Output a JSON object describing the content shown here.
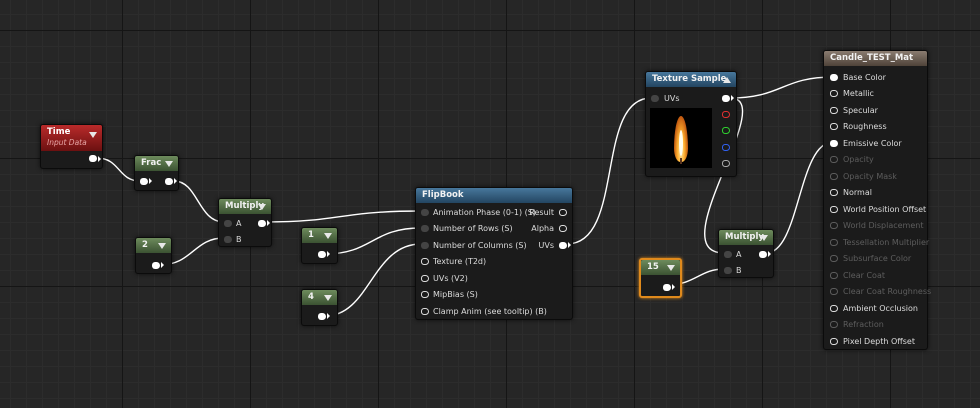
{
  "nodes": {
    "time": {
      "title": "Time",
      "subtitle": "Input Data"
    },
    "frac": {
      "title": "Frac"
    },
    "multiply1": {
      "title": "Multiply",
      "input_a": "A",
      "input_b": "B"
    },
    "const2": {
      "value": "2"
    },
    "const1": {
      "value": "1"
    },
    "const4": {
      "value": "4"
    },
    "flipbook": {
      "title": "FlipBook",
      "inputs": [
        "Animation  Phase (0-1) (S)",
        "Number of Rows (S)",
        "Number of Columns (S)",
        "Texture (T2d)",
        "UVs (V2)",
        "MipBias (S)",
        "Clamp Anim (see tooltip) (B)"
      ],
      "outputs": [
        "Result",
        "Alpha",
        "UVs"
      ]
    },
    "texture_sample": {
      "title": "Texture Sample",
      "input_uvs": "UVs"
    },
    "const15": {
      "value": "15"
    },
    "multiply2": {
      "title": "Multiply",
      "input_a": "A",
      "input_b": "B"
    },
    "material": {
      "title": "Candle_TEST_Mat",
      "inputs": [
        {
          "label": "Base Color",
          "active": true
        },
        {
          "label": "Metallic",
          "active": true
        },
        {
          "label": "Specular",
          "active": true
        },
        {
          "label": "Roughness",
          "active": true
        },
        {
          "label": "Emissive Color",
          "active": true
        },
        {
          "label": "Opacity",
          "active": false
        },
        {
          "label": "Opacity Mask",
          "active": false
        },
        {
          "label": "Normal",
          "active": true
        },
        {
          "label": "World Position Offset",
          "active": true
        },
        {
          "label": "World Displacement",
          "active": false
        },
        {
          "label": "Tessellation Multiplier",
          "active": false
        },
        {
          "label": "Subsurface Color",
          "active": false
        },
        {
          "label": "Clear Coat",
          "active": false
        },
        {
          "label": "Clear Coat Roughness",
          "active": false
        },
        {
          "label": "Ambient Occlusion",
          "active": true
        },
        {
          "label": "Refraction",
          "active": false
        },
        {
          "label": "Pixel Depth Offset",
          "active": true
        }
      ]
    }
  },
  "colors": {
    "wire": "#ffffff",
    "time_header": "#8b1c1c",
    "function_header": "#4a6a3e",
    "texture_header": "#2f5676",
    "material_header": "#665a50",
    "selection": "#e08a1c"
  }
}
